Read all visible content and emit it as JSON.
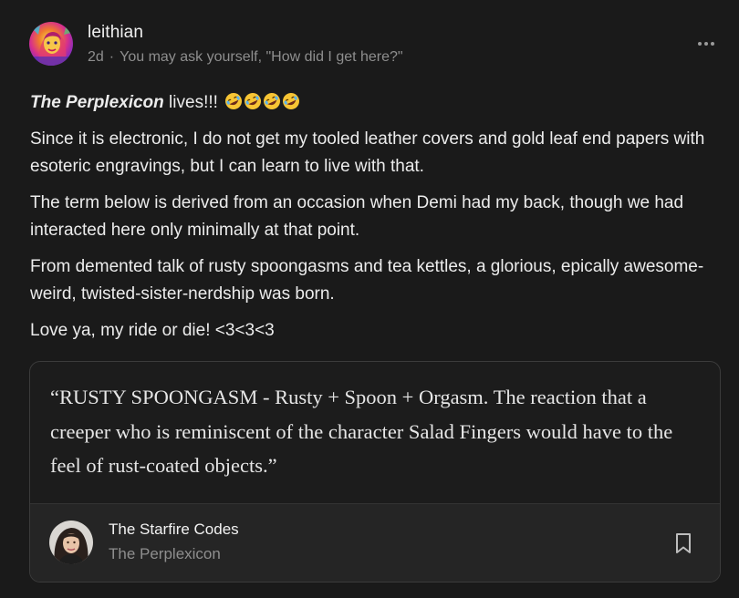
{
  "post": {
    "author": "leithian",
    "time": "2d",
    "separator": "·",
    "tagline": "You may ask yourself, \"How did I get here?\"",
    "more_icon": "more-horizontal-icon",
    "paragraphs": {
      "p1_title": "The Perplexicon",
      "p1_rest": " lives!!!",
      "p1_emoji": "rolling-on-floor-laughing-icon",
      "p2": "Since it is electronic, I do not get my tooled leather covers and gold leaf end papers with esoteric engravings, but I can learn to live with that.",
      "p3": "The term below is derived from an occasion when Demi had my back, though we had interacted here only minimally at that point.",
      "p4": "From demented talk of rusty spoongasms and tea kettles, a glorious, epically awesome-weird, twisted-sister-nerdship was born.",
      "p5": "Love ya, my ride or die! <3<3<3"
    }
  },
  "quote": {
    "text": "“RUSTY SPOONGASM - Rusty + Spoon + Orgasm. The reaction that a creeper who is reminiscent of the character Salad Fingers would have to the feel of rust-coated objects.”",
    "source_name": "The Starfire Codes",
    "source_publication": "The Perplexicon",
    "bookmark_icon": "bookmark-icon"
  },
  "colors": {
    "background": "#1a1a1a",
    "text": "#ececec",
    "muted": "#8e8e8e",
    "card_border": "#3b3b3b",
    "card_footer": "#252525"
  }
}
